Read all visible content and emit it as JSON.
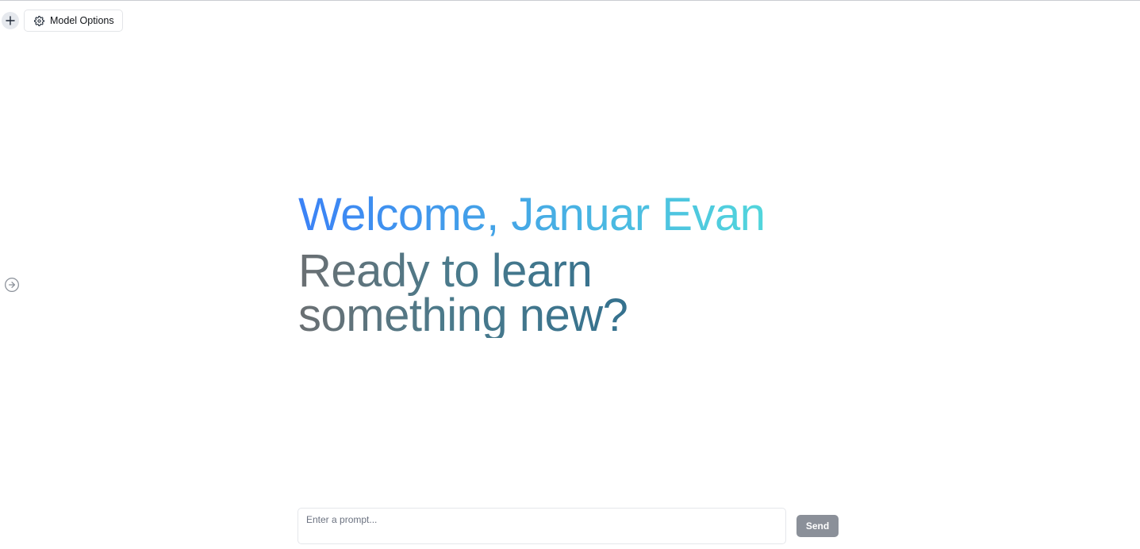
{
  "toolbar": {
    "new_chat_icon": "plus-icon",
    "model_options_label": "Model Options",
    "model_options_icon": "gear-icon"
  },
  "sidebar_toggle": {
    "icon": "arrow-right-circle-icon"
  },
  "hero": {
    "welcome": "Welcome, Januar Evan",
    "tagline": "Ready to learn something new?"
  },
  "composer": {
    "placeholder": "Enter a prompt...",
    "value": "",
    "send_label": "Send"
  },
  "colors": {
    "welcome_gradient": [
      "#3b82f6",
      "#52d6dc"
    ],
    "tagline_gradient": [
      "#6b6f72",
      "#2f6f8f"
    ],
    "send_button": "#8b9099"
  }
}
